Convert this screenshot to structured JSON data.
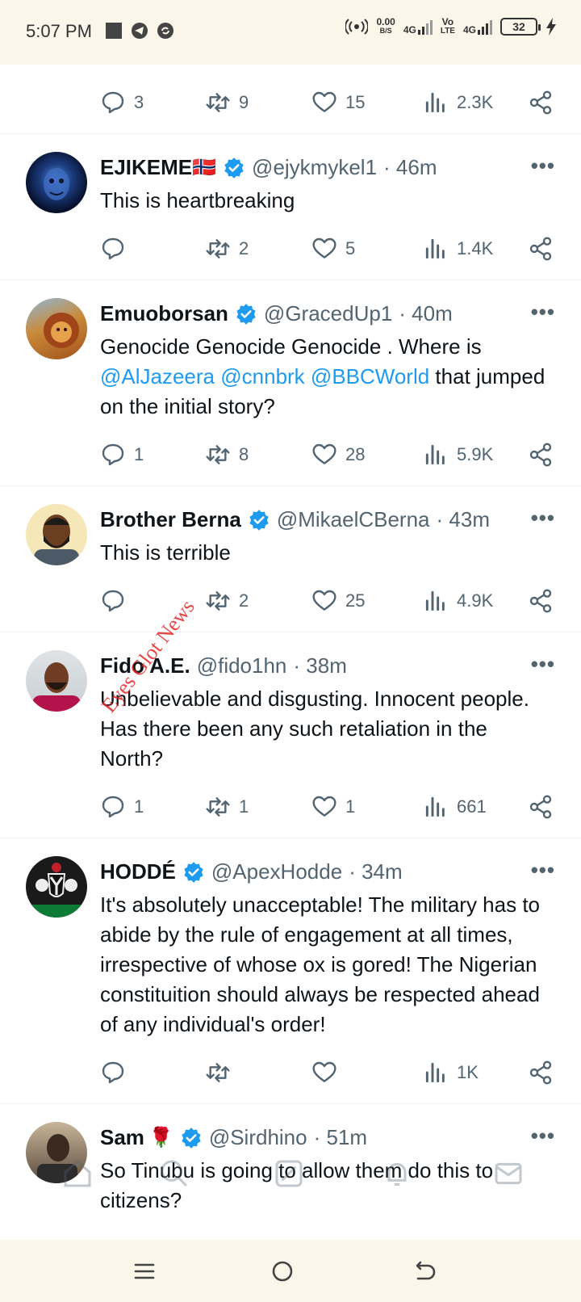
{
  "status_bar": {
    "time": "5:07 PM",
    "speed_value": "0.00",
    "speed_unit": "B/S",
    "net1": "4G",
    "volte_top": "Vo",
    "volte_bottom": "LTE",
    "net2": "4G",
    "battery": "32",
    "icons": [
      "square-notification-icon",
      "telegram-icon",
      "sync-icon",
      "hotspot-icon",
      "signal-icon",
      "charging-icon"
    ]
  },
  "colors": {
    "accent": "#1d9bf0",
    "text": "#0f1419",
    "muted": "#536471",
    "watermark": "#e32626"
  },
  "top_partial": {
    "replies": "3",
    "retweets": "9",
    "likes": "15",
    "views": "2.3K"
  },
  "tweets": [
    {
      "name": "EJIKEME",
      "flag": "🇳🇴",
      "handle": "@ejykmykel1",
      "time": "· 46m",
      "text": "This is heartbreaking",
      "replies": "",
      "retweets": "2",
      "likes": "5",
      "views": "1.4K"
    },
    {
      "name": "Emuoborsan",
      "handle": "@GracedUp1",
      "time": "· 40m",
      "text_before": "Genocide Genocide Genocide . Where is ",
      "mentions": [
        "@AlJazeera",
        "@cnnbrk",
        "@BBCWorld"
      ],
      "text_after": " that jumped on the initial story?",
      "replies": "1",
      "retweets": "8",
      "likes": "28",
      "views": "5.9K"
    },
    {
      "name": "Brother Berna",
      "handle": "@MikaelCBerna",
      "time": "· 43m",
      "text": "This is terrible",
      "replies": "",
      "retweets": "2",
      "likes": "25",
      "views": "4.9K"
    },
    {
      "name": "Fido A.E.",
      "handle": "@fido1hn",
      "time": "· 38m",
      "text": "Unbelievable and disgusting. Innocent people. Has there been any such retaliation in the North?",
      "replies": "1",
      "retweets": "1",
      "likes": "1",
      "views": "661"
    },
    {
      "name": "HODDÉ",
      "handle": "@ApexHodde",
      "time": "· 34m",
      "text": "It's absolutely unacceptable! The military has to abide by the rule of engagement at all times, irrespective of whose ox is gored! The Nigerian constituition should always be respected ahead of any individual's order!",
      "replies": "",
      "retweets": "",
      "likes": "",
      "views": "1K"
    },
    {
      "name": "Sam",
      "flag": "🌹",
      "handle": "@Sirdhino",
      "time": "· 51m",
      "text": "So Tinubu is going to allow them do this to citizens?"
    }
  ],
  "watermark": "Eyes Glot News"
}
